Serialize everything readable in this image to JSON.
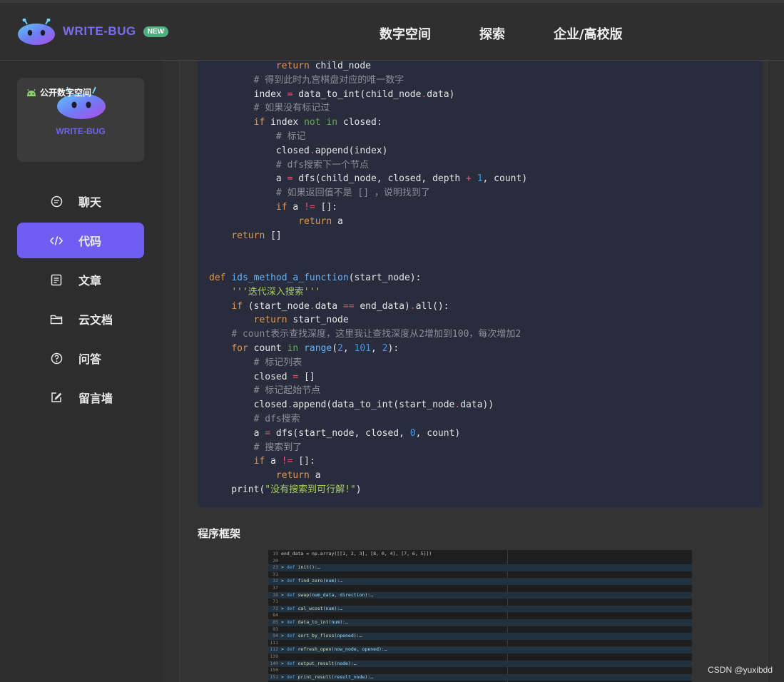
{
  "header": {
    "brand": "WRITE-BUG",
    "badge": "NEW",
    "nav": [
      {
        "label": "数字空间"
      },
      {
        "label": "探索"
      },
      {
        "label": "企业/高校版"
      }
    ]
  },
  "sidebar": {
    "promo_tag": "公开数字空间",
    "promo_brand": "WRITE-BUG",
    "items": [
      {
        "label": "聊天",
        "icon": "chat-icon"
      },
      {
        "label": "代码",
        "icon": "code-icon",
        "active": true
      },
      {
        "label": "文章",
        "icon": "article-icon"
      },
      {
        "label": "云文档",
        "icon": "folder-icon"
      },
      {
        "label": "问答",
        "icon": "question-icon"
      },
      {
        "label": "留言墙",
        "icon": "edit-icon"
      }
    ]
  },
  "section_title": "程序框架",
  "screenshot_lines": [
    {
      "n": "19",
      "text": "end_data = np.array([[1, 2, 3], [8, 0, 4], [7, 6, 5]])"
    },
    {
      "n": "20",
      "text": ""
    },
    {
      "n": "23",
      "text": "def init():…"
    },
    {
      "n": "31",
      "text": ""
    },
    {
      "n": "32",
      "text": "def find_zero(num):…"
    },
    {
      "n": "37",
      "text": ""
    },
    {
      "n": "38",
      "text": "def swap(num_data, direction):…"
    },
    {
      "n": "71",
      "text": ""
    },
    {
      "n": "72",
      "text": "def cal_wcost(num):…"
    },
    {
      "n": "84",
      "text": ""
    },
    {
      "n": "85",
      "text": "def data_to_int(num):…"
    },
    {
      "n": "93",
      "text": ""
    },
    {
      "n": "94",
      "text": "def sort_by_floss(opened):…"
    },
    {
      "n": "111",
      "text": ""
    },
    {
      "n": "112",
      "text": "def refresh_open(now_node, opened):…"
    },
    {
      "n": "139",
      "text": ""
    },
    {
      "n": "140",
      "text": "def output_result(node):…"
    },
    {
      "n": "150",
      "text": ""
    },
    {
      "n": "151",
      "text": "def print_result(result_node):…"
    }
  ],
  "watermark": "CSDN @yuxibdd",
  "colors": {
    "accent": "#6e5ff2",
    "code_bg": "#282c3c",
    "keyword": "#e4974a",
    "comment": "#8b8f9c",
    "string": "#a8cf5c",
    "number": "#3d9be9"
  }
}
